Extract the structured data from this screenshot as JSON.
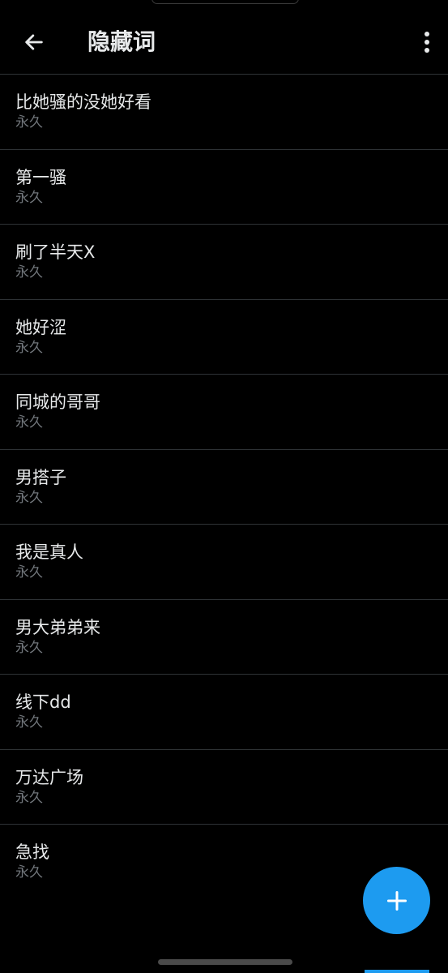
{
  "header": {
    "title": "隐藏词",
    "back_icon": "arrow-left-icon",
    "more_icon": "more-vertical-icon"
  },
  "items": [
    {
      "word": "比她骚的没她好看",
      "duration": "永久"
    },
    {
      "word": "第一骚",
      "duration": "永久"
    },
    {
      "word": "刷了半天X",
      "duration": "永久"
    },
    {
      "word": "她好涩",
      "duration": "永久"
    },
    {
      "word": "同城的哥哥",
      "duration": "永久"
    },
    {
      "word": "男搭子",
      "duration": "永久"
    },
    {
      "word": "我是真人",
      "duration": "永久"
    },
    {
      "word": "男大弟弟来",
      "duration": "永久"
    },
    {
      "word": "线下dd",
      "duration": "永久"
    },
    {
      "word": "万达广场",
      "duration": "永久"
    },
    {
      "word": "急找",
      "duration": "永久"
    }
  ],
  "fab": {
    "icon": "plus-icon"
  },
  "colors": {
    "background": "#000000",
    "text_primary": "#e7e9ea",
    "text_secondary": "#71767b",
    "divider": "#2f3336",
    "accent": "#1d9bf0"
  }
}
